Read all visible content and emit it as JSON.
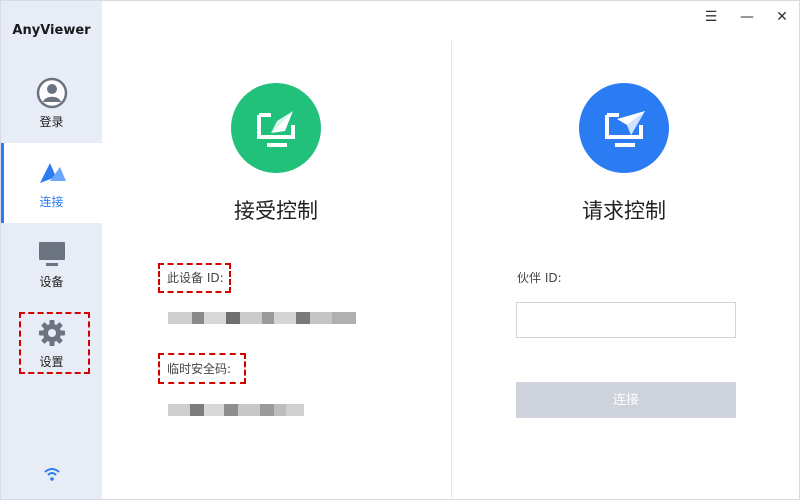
{
  "app": {
    "title": "AnyViewer"
  },
  "window_controls": {
    "menu": "☰",
    "minimize": "—",
    "close": "✕"
  },
  "sidebar": {
    "items": [
      {
        "label": "登录",
        "icon": "user-icon"
      },
      {
        "label": "连接",
        "icon": "connect-icon",
        "active": true
      },
      {
        "label": "设备",
        "icon": "monitor-icon"
      },
      {
        "label": "设置",
        "icon": "gear-icon"
      }
    ],
    "footer_icon": "wifi-icon"
  },
  "left_panel": {
    "title": "接受控制",
    "icon": "receive-control-icon",
    "icon_color": "#21c07b",
    "device_id_label": "此设备 ID:",
    "temp_code_label": "临时安全码:"
  },
  "right_panel": {
    "title": "请求控制",
    "icon": "request-control-icon",
    "icon_color": "#2b7cf3",
    "partner_id_label": "伙伴 ID:",
    "partner_id_value": "",
    "connect_button": "连接"
  },
  "colors": {
    "accent": "#2b7cf3",
    "green": "#21c07b",
    "highlight": "#d40000"
  }
}
